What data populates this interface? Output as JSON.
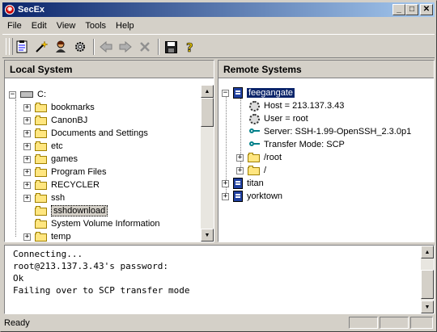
{
  "window": {
    "title": "SecEx"
  },
  "menu": [
    "File",
    "Edit",
    "View",
    "Tools",
    "Help"
  ],
  "toolbar_icons": [
    "clipboard-icon",
    "wand-icon",
    "user-icon",
    "gear-icon",
    "back-arrow-icon",
    "forward-arrow-icon",
    "stop-x-icon",
    "save-disk-icon",
    "help-icon"
  ],
  "local": {
    "header": "Local System",
    "root": "C:",
    "items": [
      "bookmarks",
      "CanonBJ",
      "Documents and Settings",
      "etc",
      "games",
      "Program Files",
      "RECYCLER",
      "ssh",
      "sshdownload",
      "System Volume Information",
      "temp"
    ],
    "selected": "sshdownload"
  },
  "remote": {
    "header": "Remote Systems",
    "host_name": "feegangate",
    "details": [
      "Host = 213.137.3.43",
      "User = root",
      "Server: SSH-1.99-OpenSSH_2.3.0p1",
      "Transfer Mode: SCP"
    ],
    "folders": [
      "/root",
      "/"
    ],
    "others": [
      "titan",
      "yorktown"
    ]
  },
  "console": {
    "lines": [
      "Connecting...",
      "root@213.137.3.43's password:",
      "Ok",
      "Failing over to SCP transfer mode"
    ]
  },
  "status": {
    "text": "Ready"
  },
  "colors": {
    "title_start": "#0a246a",
    "title_end": "#a6caf0",
    "face": "#d4d0c8",
    "selection": "#0a246a"
  }
}
